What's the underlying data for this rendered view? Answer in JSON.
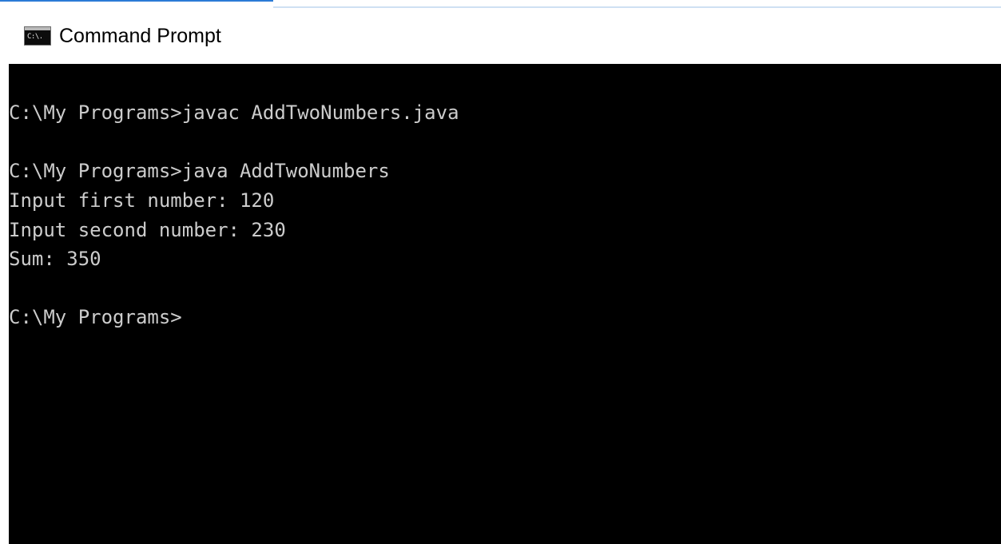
{
  "window": {
    "title": "Command Prompt",
    "icon": "cmd-icon",
    "icon_text": "C:\\."
  },
  "console": {
    "lines": [
      "C:\\My Programs>javac AddTwoNumbers.java",
      "",
      "C:\\My Programs>java AddTwoNumbers",
      "Input first number: 120",
      "Input second number: 230",
      "Sum: 350",
      "",
      "C:\\My Programs>"
    ]
  },
  "colors": {
    "console_background": "#000000",
    "console_text": "#cccccc",
    "titlebar_background": "#ffffff",
    "accent": "#2b7bd6"
  }
}
